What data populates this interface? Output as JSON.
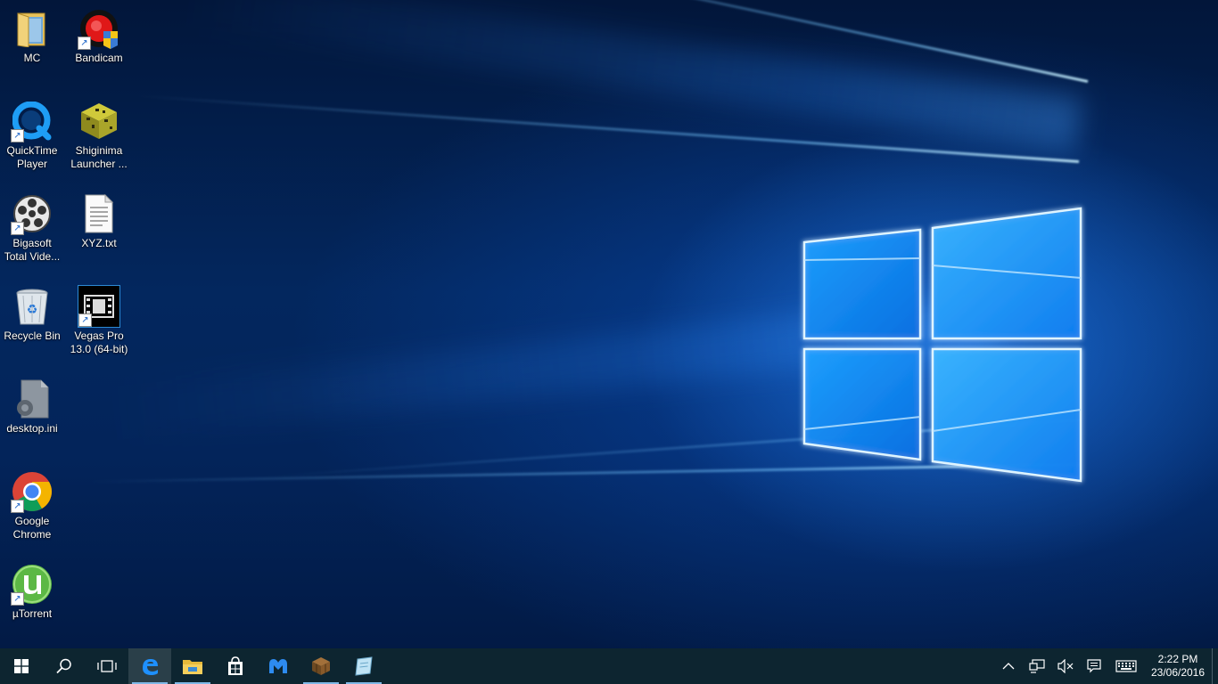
{
  "desktop": {
    "icons": [
      {
        "label": "MC",
        "icon": "folder-icon"
      },
      {
        "label": "Bandicam",
        "icon": "bandicam-icon"
      },
      {
        "label": "QuickTime\nPlayer",
        "icon": "quicktime-icon"
      },
      {
        "label": "Shiginima\nLauncher ...",
        "icon": "minecraft-block-icon"
      },
      {
        "label": "Bigasoft\nTotal Vide...",
        "icon": "film-reel-icon"
      },
      {
        "label": "XYZ.txt",
        "icon": "text-file-icon"
      },
      {
        "label": "Recycle Bin",
        "icon": "recycle-bin-icon"
      },
      {
        "label": "Vegas Pro\n13.0 (64-bit)",
        "icon": "vegas-pro-icon"
      },
      {
        "label": "desktop.ini",
        "icon": "settings-file-icon"
      },
      {
        "label": "Google\nChrome",
        "icon": "chrome-icon"
      },
      {
        "label": "µTorrent",
        "icon": "utorrent-icon"
      }
    ]
  },
  "taskbar": {
    "pinned": [
      {
        "name": "start",
        "icon": "windows-logo-icon"
      },
      {
        "name": "search",
        "icon": "search-icon"
      },
      {
        "name": "task-view",
        "icon": "task-view-icon"
      },
      {
        "name": "edge",
        "icon": "edge-icon"
      },
      {
        "name": "file-explorer",
        "icon": "folder-icon"
      },
      {
        "name": "store",
        "icon": "store-icon"
      },
      {
        "name": "malwarebytes",
        "icon": "malwarebytes-icon"
      },
      {
        "name": "minecraft",
        "icon": "crafting-table-icon"
      },
      {
        "name": "notepad",
        "icon": "notepad-icon"
      }
    ],
    "tray": {
      "time": "2:22 PM",
      "date": "23/06/2016"
    }
  },
  "colors": {
    "taskbar": "#0d2530",
    "accent": "#1e90ff"
  }
}
